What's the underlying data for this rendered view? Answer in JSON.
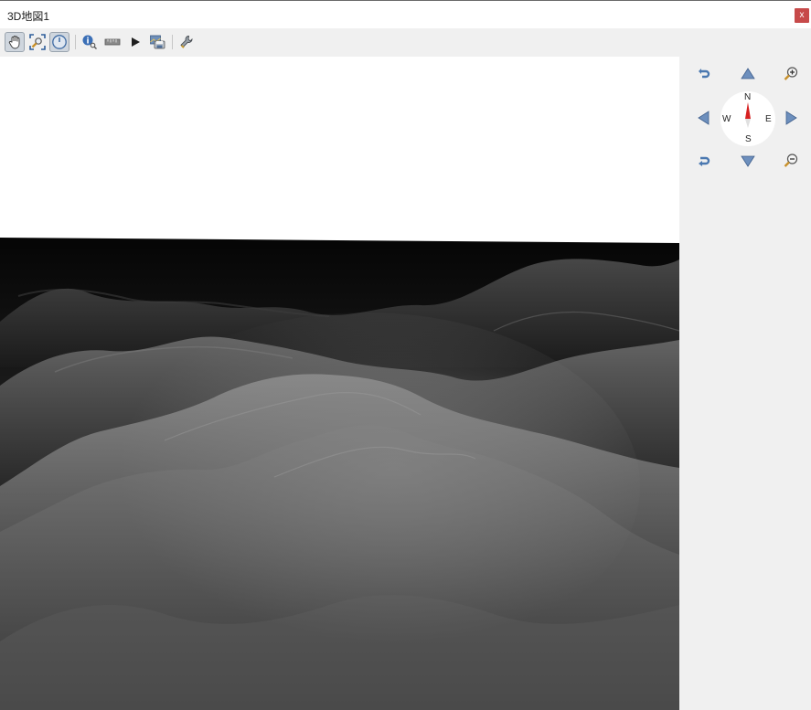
{
  "window": {
    "title": "3D地図1",
    "close_label": "x"
  },
  "toolbar": {
    "items": [
      {
        "name": "camera-control-icon",
        "tooltip": "",
        "active": true
      },
      {
        "name": "zoom-full-icon",
        "active": false
      },
      {
        "name": "toggle-on-screen-navigation-icon",
        "active": true
      },
      {
        "name": "identify-icon",
        "active": false
      },
      {
        "name": "measure-line-icon",
        "active": false
      },
      {
        "name": "animations-play-icon",
        "active": false
      },
      {
        "name": "save-as-image-icon",
        "active": false
      },
      {
        "name": "configure-icon",
        "active": false
      }
    ]
  },
  "navigation": {
    "compass": {
      "north": "N",
      "south": "S",
      "east": "E",
      "west": "W"
    },
    "controls": [
      "rotate-left-icon",
      "move-up-icon",
      "zoom-in-icon",
      "move-left-icon",
      "move-right-icon",
      "rotate-right-icon",
      "move-down-icon",
      "zoom-out-icon"
    ]
  },
  "colors": {
    "accent_blue": "#4a78b0",
    "compass_needle": "#d62020",
    "close_red": "#c74a4a"
  }
}
